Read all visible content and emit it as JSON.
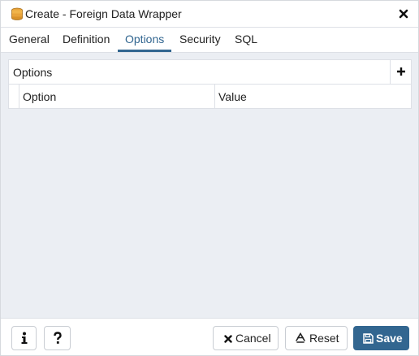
{
  "dialog": {
    "title": "Create - Foreign Data Wrapper",
    "icon": "database-icon",
    "close_icon": "close-icon"
  },
  "tabs": [
    {
      "label": "General",
      "active": false
    },
    {
      "label": "Definition",
      "active": false
    },
    {
      "label": "Options",
      "active": true
    },
    {
      "label": "Security",
      "active": false
    },
    {
      "label": "SQL",
      "active": false
    }
  ],
  "options_panel": {
    "title": "Options",
    "add_icon": "plus-icon",
    "columns": [
      "Option",
      "Value"
    ]
  },
  "footer": {
    "info_icon": "info-icon",
    "help_icon": "question-icon",
    "cancel_label": "Cancel",
    "reset_label": "Reset",
    "save_label": "Save"
  },
  "colors": {
    "accent": "#326690",
    "body_background": "#ebeef3",
    "border": "#dde0e6"
  }
}
